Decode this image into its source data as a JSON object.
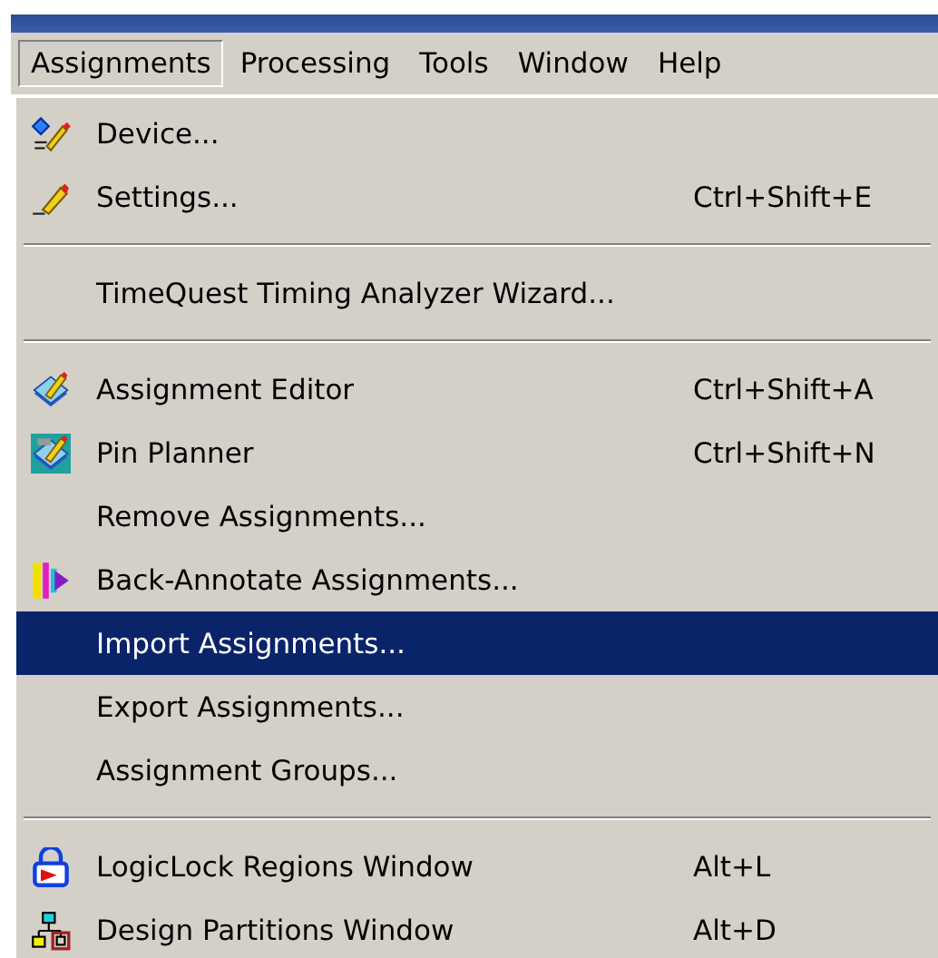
{
  "menu_bar": [
    {
      "label": "Assignments",
      "selected": true
    },
    {
      "label": "Processing",
      "selected": false
    },
    {
      "label": "Tools",
      "selected": false
    },
    {
      "label": "Window",
      "selected": false
    },
    {
      "label": "Help",
      "selected": false
    }
  ],
  "menu": [
    {
      "kind": "item",
      "label": "Device...",
      "selected": false
    },
    {
      "kind": "item",
      "label": "Settings...",
      "shortcut": "Ctrl+Shift+E",
      "selected": false
    },
    {
      "kind": "separator"
    },
    {
      "kind": "item",
      "label": "TimeQuest Timing Analyzer Wizard...",
      "selected": false
    },
    {
      "kind": "separator"
    },
    {
      "kind": "item",
      "label": "Assignment Editor",
      "shortcut": "Ctrl+Shift+A",
      "selected": false
    },
    {
      "kind": "item",
      "label": "Pin Planner",
      "shortcut": "Ctrl+Shift+N",
      "selected": false
    },
    {
      "kind": "item",
      "label": "Remove Assignments...",
      "selected": false
    },
    {
      "kind": "item",
      "label": "Back-Annotate Assignments...",
      "selected": false
    },
    {
      "kind": "item",
      "label": "Import Assignments...",
      "selected": true
    },
    {
      "kind": "item",
      "label": "Export Assignments...",
      "selected": false
    },
    {
      "kind": "item",
      "label": "Assignment Groups...",
      "selected": false
    },
    {
      "kind": "separator"
    },
    {
      "kind": "item",
      "label": "LogicLock Regions Window",
      "shortcut": "Alt+L",
      "selected": false
    },
    {
      "kind": "item",
      "label": "Design Partitions Window",
      "shortcut": "Alt+D",
      "selected": false
    }
  ]
}
